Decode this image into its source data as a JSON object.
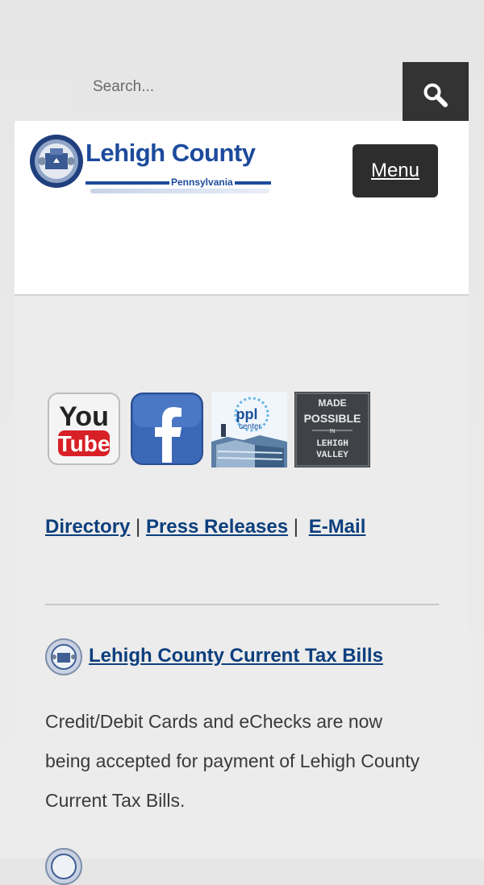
{
  "search": {
    "placeholder": "Search..."
  },
  "header": {
    "logo_title": "Lehigh County",
    "logo_subtitle": "Pennsylvania",
    "menu_label": "Menu"
  },
  "social": [
    {
      "name": "YouTube",
      "icon": "youtube-icon"
    },
    {
      "name": "Facebook",
      "icon": "facebook-icon"
    },
    {
      "name": "PPL Center",
      "icon": "ppl-center-icon"
    },
    {
      "name": "Made Possible in Lehigh Valley",
      "icon": "made-possible-icon"
    }
  ],
  "links": {
    "directory": "Directory",
    "sep1": "|",
    "press_releases": "Press Releases",
    "sep2": "|",
    "email": "E-Mail"
  },
  "news": {
    "title": "Lehigh County Current Tax Bills",
    "body": "Credit/Debit Cards and eChecks are now being accepted for payment of Lehigh County Current Tax Bills."
  },
  "colors": {
    "link": "#0d3f7d",
    "brand": "#1c4a9c",
    "dark": "#333333"
  }
}
